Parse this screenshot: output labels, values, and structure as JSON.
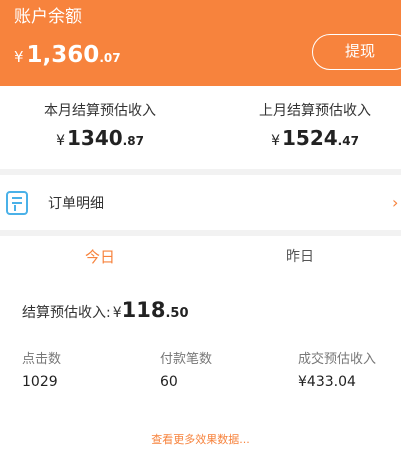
{
  "header": {
    "title": "账户余额",
    "balance_currency": "¥",
    "balance_int": "1,360",
    "balance_dec": ".07",
    "withdraw_label": "提现"
  },
  "monthly": {
    "this_month": {
      "label": "本月结算预估收入",
      "currency": "¥",
      "int": "1340",
      "dec": ".87"
    },
    "last_month": {
      "label": "上月结算预估收入",
      "currency": "¥",
      "int": "1524",
      "dec": ".47"
    }
  },
  "order_detail": {
    "label": "订单明细",
    "chevron": "›"
  },
  "daily": {
    "tabs": [
      {
        "label": "今日",
        "active": true
      },
      {
        "label": "昨日",
        "active": false
      }
    ],
    "settle_label": "结算预估收入:",
    "settle_currency": "¥",
    "settle_int": "118",
    "settle_dec": ".50",
    "stats": [
      {
        "label": "点击数",
        "value": "1029"
      },
      {
        "label": "付款笔数",
        "value": "60"
      },
      {
        "label": "成交预估收入",
        "value": "¥433.04"
      }
    ],
    "more_link": "查看更多效果数据..."
  },
  "colors": {
    "accent": "#f7833d",
    "icon": "#4ab1e8"
  }
}
